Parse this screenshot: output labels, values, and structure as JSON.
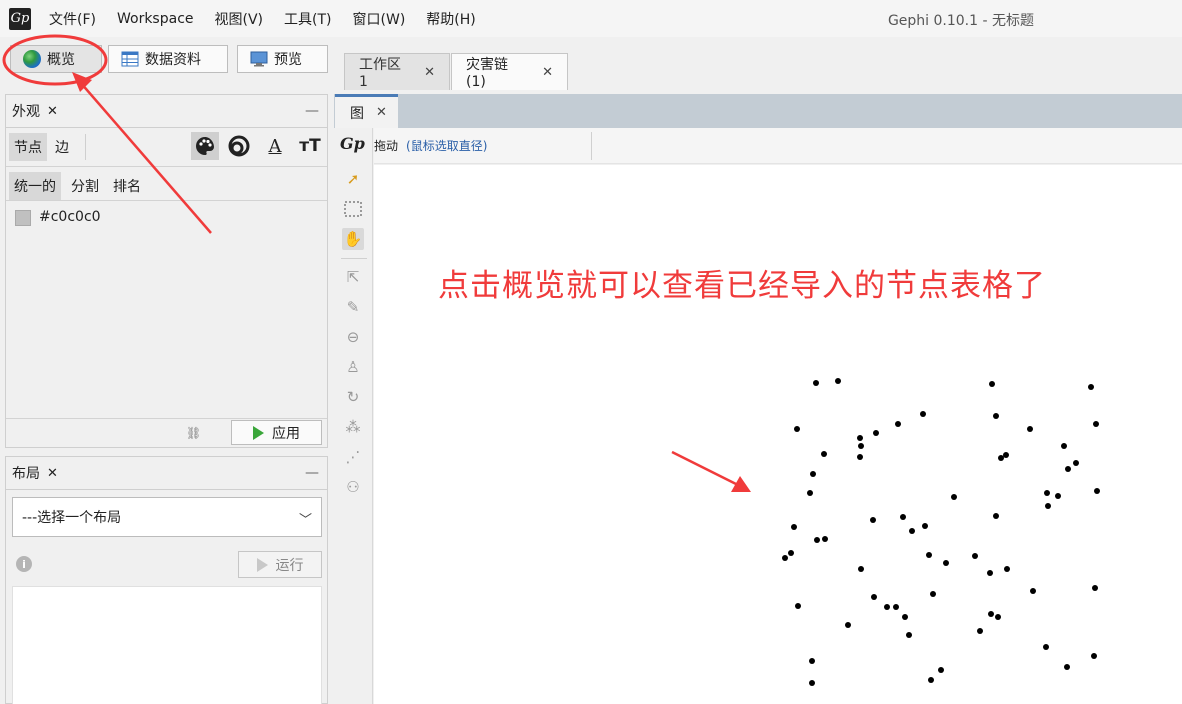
{
  "menubar": {
    "logo": "Gp",
    "items": [
      "文件(F)",
      "Workspace",
      "视图(V)",
      "工具(T)",
      "窗口(W)",
      "帮助(H)"
    ],
    "window_title": "Gephi 0.10.1 - 无标题"
  },
  "modes": {
    "overview": "概览",
    "data_lab": "数据资料",
    "preview": "预览"
  },
  "doc_tabs": [
    {
      "label": "工作区 1",
      "active": false
    },
    {
      "label": "灾害链 (1)",
      "active": true
    }
  ],
  "appearance": {
    "title": "外观",
    "element_tabs": [
      "节点",
      "边"
    ],
    "attr_icons": [
      "palette-icon",
      "size-icon",
      "label-color-icon",
      "label-size-icon"
    ],
    "transform_tabs": [
      "统一的",
      "分割",
      "排名"
    ],
    "color_value": "#c0c0c0",
    "apply_label": "应用"
  },
  "layout": {
    "title": "布局",
    "select_placeholder": "---选择一个布局",
    "run_label": "运行"
  },
  "graph": {
    "tab_label": "图",
    "mode_label": "拖动",
    "hint": "(鼠标选取直径)",
    "logo": "Gp",
    "tools": [
      "select-pointer-icon",
      "rectangle-select-icon",
      "drag-hand-icon",
      "node-info-icon",
      "paint-icon",
      "resize-icon",
      "color-bucket-icon",
      "rotate-icon",
      "add-node-icon",
      "add-edge-icon",
      "shortest-path-icon"
    ],
    "node_color": "#000000",
    "node_count": 67
  },
  "annotation": {
    "text": "点击概览就可以查看已经导入的节点表格了",
    "color": "#f03b3b"
  }
}
